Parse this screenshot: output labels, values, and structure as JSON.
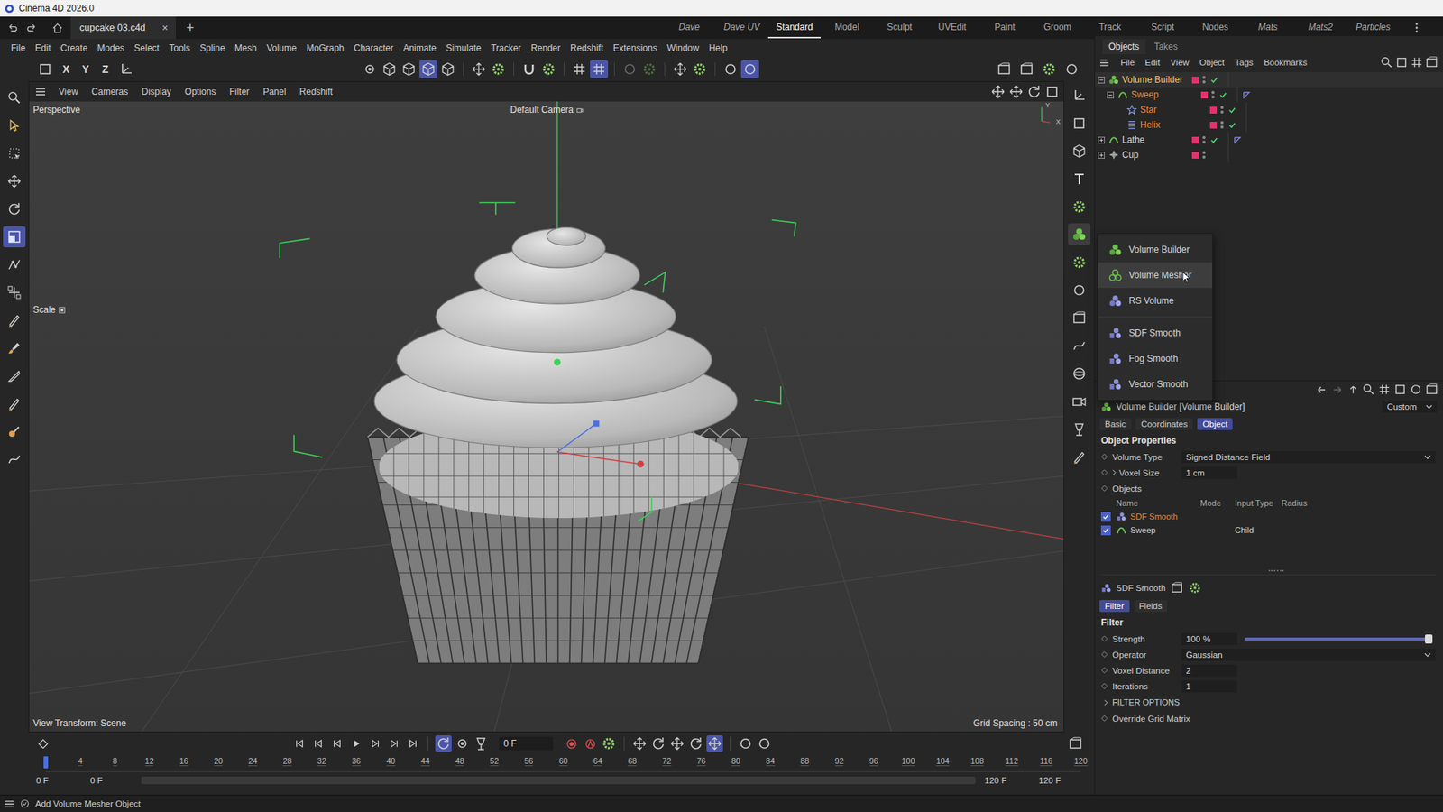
{
  "window": {
    "title": "Cinema 4D 2026.0"
  },
  "doc_tabs": [
    {
      "label": "cupcake 03.c4d",
      "selected": true,
      "close": "×"
    }
  ],
  "new_tab": "+",
  "layouts": [
    {
      "label": "Dave",
      "selected": false,
      "custom": true
    },
    {
      "label": "Dave UV",
      "selected": false,
      "custom": true
    },
    {
      "label": "Standard",
      "selected": true,
      "custom": false
    },
    {
      "label": "Model",
      "selected": false,
      "custom": false
    },
    {
      "label": "Sculpt",
      "selected": false,
      "custom": false
    },
    {
      "label": "UVEdit",
      "selected": false,
      "custom": false
    },
    {
      "label": "Paint",
      "selected": false,
      "custom": false
    },
    {
      "label": "Groom",
      "selected": false,
      "custom": false
    },
    {
      "label": "Track",
      "selected": false,
      "custom": false
    },
    {
      "label": "Script",
      "selected": false,
      "custom": false
    },
    {
      "label": "Nodes",
      "selected": false,
      "custom": false
    },
    {
      "label": "Mats",
      "selected": false,
      "custom": true
    },
    {
      "label": "Mats2",
      "selected": false,
      "custom": true
    },
    {
      "label": "Particles",
      "selected": false,
      "custom": true
    }
  ],
  "menu": [
    "File",
    "Edit",
    "Create",
    "Modes",
    "Select",
    "Tools",
    "Spline",
    "Mesh",
    "Volume",
    "MoGraph",
    "Character",
    "Animate",
    "Simulate",
    "Tracker",
    "Render",
    "Redshift",
    "Extensions",
    "Window",
    "Help"
  ],
  "toolbar": {
    "axis_locks": [
      "X",
      "Y",
      "Z"
    ],
    "buttons": [
      {
        "selected": false,
        "disabled": false
      },
      {
        "selected": false,
        "disabled": false
      },
      {
        "selected": false,
        "disabled": false
      },
      {
        "selected": true,
        "disabled": false
      },
      {
        "selected": false,
        "disabled": false
      },
      {
        "selected": false,
        "disabled": false
      },
      {
        "selected": false,
        "disabled": false
      },
      {
        "selected": false,
        "disabled": false
      },
      {
        "selected": false,
        "disabled": false
      },
      {
        "selected": false,
        "disabled": false
      },
      {
        "selected": true,
        "disabled": false
      },
      {
        "selected": false,
        "disabled": true
      },
      {
        "selected": false,
        "disabled": true
      },
      {
        "selected": false,
        "disabled": false
      },
      {
        "selected": false,
        "disabled": false
      },
      {
        "selected": false,
        "disabled": false
      },
      {
        "selected": true,
        "disabled": false
      }
    ]
  },
  "tools": [
    {
      "selected": false
    },
    {
      "selected": false
    },
    {
      "selected": false
    },
    {
      "selected": false
    },
    {
      "selected": false
    },
    {
      "selected": true
    },
    {
      "selected": false
    },
    {
      "selected": false
    },
    {
      "selected": false
    },
    {
      "selected": false
    },
    {
      "selected": false
    },
    {
      "selected": false
    },
    {
      "selected": false
    },
    {
      "selected": false
    }
  ],
  "palette": [
    {
      "selected": false
    },
    {
      "selected": false
    },
    {
      "selected": false
    },
    {
      "selected": false
    },
    {
      "selected": false
    },
    {
      "selected": true
    },
    {
      "selected": false
    },
    {
      "selected": false
    },
    {
      "selected": false
    },
    {
      "selected": false
    },
    {
      "selected": false
    },
    {
      "selected": false
    },
    {
      "selected": false
    },
    {
      "selected": false
    }
  ],
  "viewport": {
    "menu": [
      "View",
      "Cameras",
      "Display",
      "Options",
      "Filter",
      "Panel",
      "Redshift"
    ],
    "name": "Perspective",
    "camera": "Default Camera",
    "tool_label": "Scale",
    "view_transform": "View Transform: Scene",
    "grid_spacing": "Grid Spacing : 50 cm",
    "orientation": [
      "Y",
      "X"
    ]
  },
  "objects_panel": {
    "tabs": [
      {
        "label": "Objects",
        "selected": true
      },
      {
        "label": "Takes",
        "selected": false
      }
    ],
    "menu": [
      "File",
      "Edit",
      "View",
      "Object",
      "Tags",
      "Bookmarks"
    ],
    "items": [
      {
        "name": "Volume Builder",
        "depth": 0,
        "icon": "volume",
        "has_children": true,
        "expanded": true,
        "enabled": true,
        "tag": false,
        "selected": true,
        "highlighted": false
      },
      {
        "name": "Sweep",
        "depth": 1,
        "icon": "sweep",
        "has_children": true,
        "expanded": true,
        "enabled": true,
        "tag": true,
        "selected": false,
        "highlighted": true
      },
      {
        "name": "Star",
        "depth": 2,
        "icon": "star",
        "has_children": false,
        "expanded": false,
        "enabled": true,
        "tag": false,
        "selected": false,
        "highlighted": true
      },
      {
        "name": "Helix",
        "depth": 2,
        "icon": "helix",
        "has_children": false,
        "expanded": false,
        "enabled": true,
        "tag": false,
        "selected": false,
        "highlighted": true
      },
      {
        "name": "Lathe",
        "depth": 0,
        "icon": "lathe",
        "has_children": true,
        "expanded": false,
        "enabled": true,
        "tag": true,
        "selected": false,
        "highlighted": false
      },
      {
        "name": "Cup",
        "depth": 0,
        "icon": "null",
        "has_children": true,
        "expanded": false,
        "enabled": false,
        "tag": false,
        "selected": false,
        "highlighted": false
      }
    ]
  },
  "flyout": {
    "items": [
      {
        "label": "Volume Builder",
        "hovered": false,
        "group": 1,
        "kind": "builder"
      },
      {
        "label": "Volume Mesher",
        "hovered": true,
        "group": 1,
        "kind": "mesher"
      },
      {
        "label": "RS Volume",
        "hovered": false,
        "group": 1,
        "kind": "rs"
      },
      {
        "label": "SDF Smooth",
        "hovered": false,
        "group": 2,
        "kind": "filter"
      },
      {
        "label": "Fog Smooth",
        "hovered": false,
        "group": 2,
        "kind": "filter"
      },
      {
        "label": "Vector Smooth",
        "hovered": false,
        "group": 2,
        "kind": "filter"
      }
    ]
  },
  "attributes": {
    "title": "Volume Builder [Volume Builder]",
    "mode": "Custom",
    "tabs": [
      {
        "label": "Basic",
        "selected": false
      },
      {
        "label": "Coordinates",
        "selected": false
      },
      {
        "label": "Object",
        "selected": true
      }
    ],
    "section": "Object Properties",
    "fields": [
      {
        "label": "Volume Type",
        "value": "Signed Distance Field",
        "kind": "dropdown",
        "expandable": false
      },
      {
        "label": "Voxel Size",
        "value": "1 cm",
        "kind": "number",
        "expandable": true
      }
    ],
    "objects_label": "Objects",
    "columns": [
      "Name",
      "Mode",
      "Input Type",
      "Radius"
    ],
    "rows": [
      {
        "name": "SDF Smooth",
        "checked": true,
        "mode": "",
        "input_type": "",
        "radius": "",
        "kind": "filter",
        "highlighted": true
      },
      {
        "name": "Sweep",
        "checked": true,
        "mode": "",
        "input_type": "Child",
        "radius": "",
        "kind": "sweep",
        "highlighted": false
      }
    ],
    "sub": {
      "title": "SDF Smooth",
      "tabs": [
        {
          "label": "Filter",
          "selected": true
        },
        {
          "label": "Fields",
          "selected": false
        }
      ],
      "section": "Filter",
      "fields": [
        {
          "kind": "slider",
          "label": "Strength",
          "value": "100 %",
          "level": 1
        },
        {
          "kind": "dropdown",
          "label": "Operator",
          "value": "Gaussian",
          "level": 0
        },
        {
          "kind": "number",
          "label": "Voxel Distance",
          "value": "2",
          "level": 0
        },
        {
          "kind": "number",
          "label": "Iterations",
          "value": "1",
          "level": 0
        }
      ],
      "group": "FILTER OPTIONS",
      "cut_row": "Override Grid Matrix"
    }
  },
  "timeline": {
    "frame": "0 F",
    "ticks": [
      "0",
      "4",
      "8",
      "12",
      "16",
      "20",
      "24",
      "28",
      "32",
      "36",
      "40",
      "44",
      "48",
      "52",
      "56",
      "60",
      "64",
      "68",
      "72",
      "76",
      "80",
      "84",
      "88",
      "92",
      "96",
      "100",
      "104",
      "108",
      "112",
      "116",
      "120"
    ],
    "range_start": "0 F",
    "preview_start": "0 F",
    "preview_end": "120 F",
    "range_end": "120 F",
    "playhead": 0
  },
  "status_bar": {
    "text": "Add Volume Mesher Object"
  }
}
